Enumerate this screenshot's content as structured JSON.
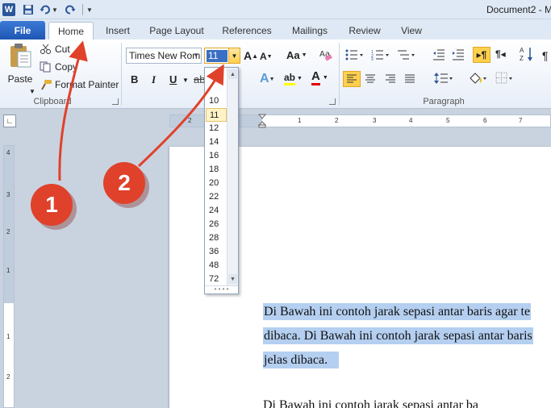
{
  "app": {
    "logo_letter": "W",
    "document_title": "Document2 - M"
  },
  "tabs": {
    "file": "File",
    "items": [
      "Home",
      "Insert",
      "Page Layout",
      "References",
      "Mailings",
      "Review",
      "View"
    ]
  },
  "clipboard": {
    "paste": "Paste",
    "cut": "Cut",
    "copy": "Copy",
    "format_painter": "Format Painter",
    "label": "Clipboard"
  },
  "font": {
    "name": "Times New Rom",
    "size": "11",
    "bold": "B",
    "italic": "I",
    "underline": "U",
    "grow": "A",
    "shrink": "A",
    "change_case": "Aa",
    "text_effect": "A",
    "highlight": "ab",
    "font_color": "A"
  },
  "paragraph": {
    "label": "Paragraph"
  },
  "size_list": [
    "10",
    "11",
    "12",
    "14",
    "16",
    "18",
    "20",
    "22",
    "24",
    "26",
    "28",
    "36",
    "48",
    "72"
  ],
  "size_selected": "11",
  "document": {
    "line1": "Di Bawah ini contoh jarak sepasi antar baris agar te",
    "line2": "dibaca. Di Bawah ini contoh jarak sepasi antar baris",
    "line3": "jelas dibaca.",
    "line4": "Di Bawah ini contoh jarak sepasi antar ba"
  },
  "callouts": [
    "1",
    "2"
  ],
  "ruler": {
    "h_numbers": [
      "2",
      "1",
      "1",
      "2",
      "3",
      "4",
      "5",
      "6",
      "7"
    ],
    "v_numbers": [
      "4",
      "3",
      "2",
      "1",
      "1",
      "2"
    ]
  },
  "colors": {
    "accent": "#2b579a",
    "file_tab": "#2a66c2",
    "highlight": "#b4cff0",
    "callout": "#e0412b",
    "combo_focus": "#e0a627"
  }
}
